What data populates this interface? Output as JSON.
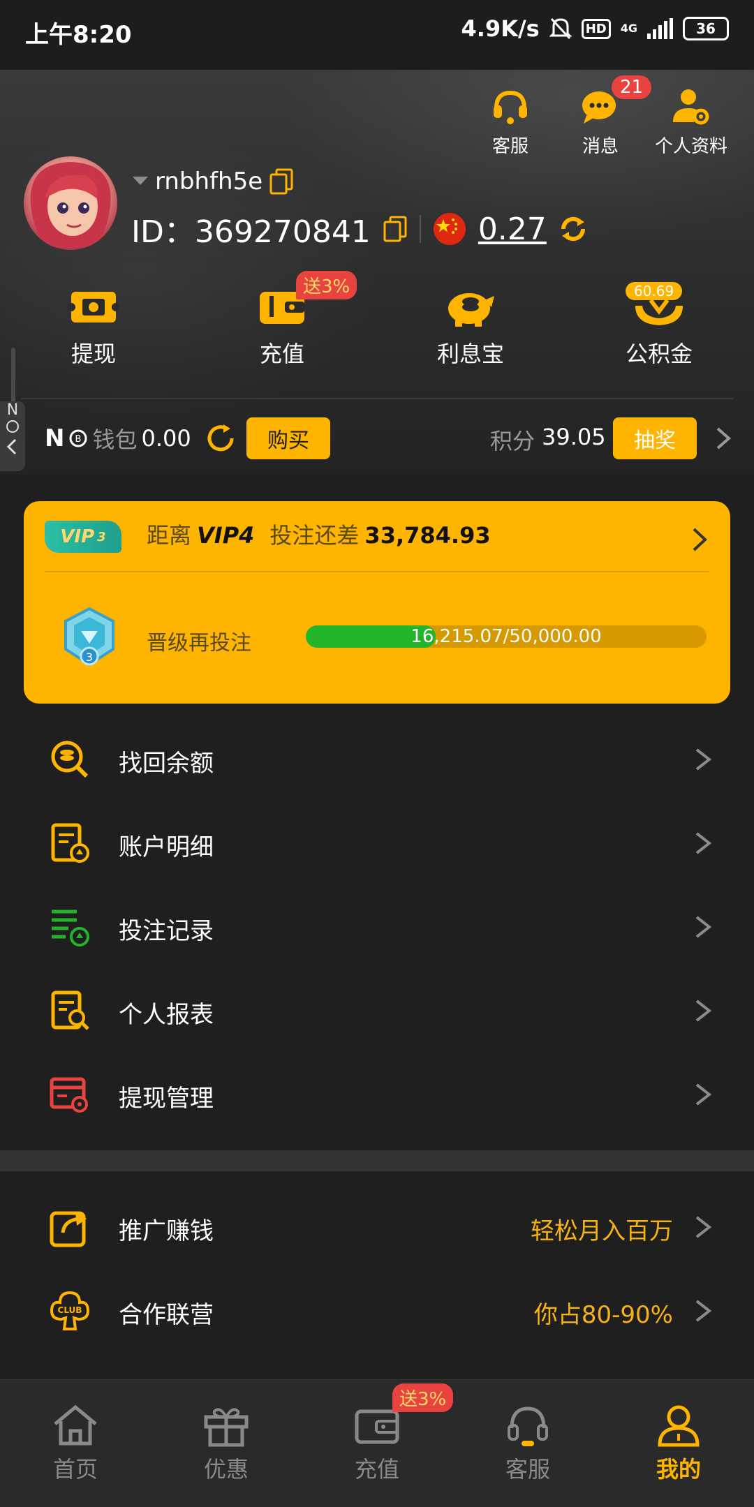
{
  "status_bar": {
    "time": "上午8:20",
    "net_speed": "4.9K/s",
    "hd": "HD",
    "network": "4G",
    "battery": "36"
  },
  "header": {
    "top_icons": [
      {
        "label": "客服",
        "icon": "headset-icon"
      },
      {
        "label": "消息",
        "icon": "chat-icon",
        "badge": "21"
      },
      {
        "label": "个人资料",
        "icon": "profile-settings-icon"
      }
    ],
    "username": "rnbhfh5e",
    "user_id": "ID：369270841",
    "balance": "0.27"
  },
  "actions": [
    {
      "label": "提现",
      "icon": "withdraw-icon"
    },
    {
      "label": "充值",
      "icon": "deposit-wallet-icon",
      "badge": "送3%"
    },
    {
      "label": "利息宝",
      "icon": "piggy-bank-icon"
    },
    {
      "label": "公积金",
      "icon": "fund-hands-icon",
      "badge": "60.69"
    }
  ],
  "wallet": {
    "logo": "N",
    "label": "钱包",
    "value": "0.00",
    "buy_label": "购买",
    "points_label": "积分",
    "points_value": "39.05",
    "lottery_label": "抽奖"
  },
  "side_tab": {
    "text": "N"
  },
  "vip": {
    "tag": "VIP",
    "tag_level": "3",
    "distance_label": "距离",
    "next_level": "VIP4",
    "diff_label": "投注还差",
    "diff_value": "33,784.93",
    "badge_level": "3",
    "upgrade_label": "晋级再投注",
    "progress_text": "16,215.07/50,000.00",
    "progress_fraction": 0.3243
  },
  "menu": [
    {
      "label": "找回余额",
      "icon": "recover-balance-icon"
    },
    {
      "label": "账户明细",
      "icon": "account-details-icon"
    },
    {
      "label": "投注记录",
      "icon": "bet-records-icon"
    },
    {
      "label": "个人报表",
      "icon": "personal-report-icon"
    },
    {
      "label": "提现管理",
      "icon": "withdraw-manage-icon"
    }
  ],
  "menu2": [
    {
      "label": "推广赚钱",
      "extra": "轻松月入百万",
      "icon": "share-icon"
    },
    {
      "label": "合作联营",
      "extra": "你占80-90%",
      "icon": "club-icon"
    }
  ],
  "bottom_nav": [
    {
      "label": "首页",
      "icon": "home-icon"
    },
    {
      "label": "优惠",
      "icon": "gift-icon"
    },
    {
      "label": "充值",
      "icon": "wallet-icon",
      "badge": "送3%"
    },
    {
      "label": "客服",
      "icon": "headset-icon"
    },
    {
      "label": "我的",
      "icon": "user-icon",
      "active": true
    }
  ],
  "colors": {
    "accent": "#ffb400",
    "background": "#1f1f1f",
    "badge_red": "#e8433f",
    "progress_green": "#22b52c"
  }
}
